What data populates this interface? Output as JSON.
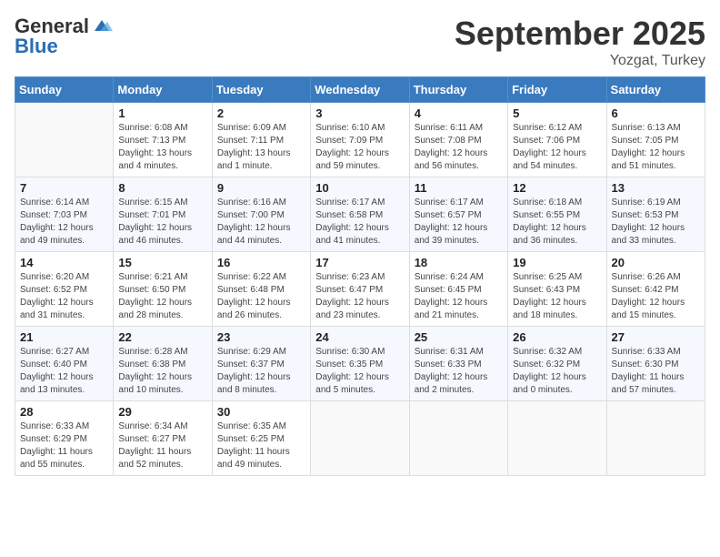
{
  "logo": {
    "general": "General",
    "blue": "Blue"
  },
  "header": {
    "title": "September 2025",
    "subtitle": "Yozgat, Turkey"
  },
  "weekdays": [
    "Sunday",
    "Monday",
    "Tuesday",
    "Wednesday",
    "Thursday",
    "Friday",
    "Saturday"
  ],
  "weeks": [
    [
      {
        "day": "",
        "sunrise": "",
        "sunset": "",
        "daylight": ""
      },
      {
        "day": "1",
        "sunrise": "Sunrise: 6:08 AM",
        "sunset": "Sunset: 7:13 PM",
        "daylight": "Daylight: 13 hours and 4 minutes."
      },
      {
        "day": "2",
        "sunrise": "Sunrise: 6:09 AM",
        "sunset": "Sunset: 7:11 PM",
        "daylight": "Daylight: 13 hours and 1 minute."
      },
      {
        "day": "3",
        "sunrise": "Sunrise: 6:10 AM",
        "sunset": "Sunset: 7:09 PM",
        "daylight": "Daylight: 12 hours and 59 minutes."
      },
      {
        "day": "4",
        "sunrise": "Sunrise: 6:11 AM",
        "sunset": "Sunset: 7:08 PM",
        "daylight": "Daylight: 12 hours and 56 minutes."
      },
      {
        "day": "5",
        "sunrise": "Sunrise: 6:12 AM",
        "sunset": "Sunset: 7:06 PM",
        "daylight": "Daylight: 12 hours and 54 minutes."
      },
      {
        "day": "6",
        "sunrise": "Sunrise: 6:13 AM",
        "sunset": "Sunset: 7:05 PM",
        "daylight": "Daylight: 12 hours and 51 minutes."
      }
    ],
    [
      {
        "day": "7",
        "sunrise": "Sunrise: 6:14 AM",
        "sunset": "Sunset: 7:03 PM",
        "daylight": "Daylight: 12 hours and 49 minutes."
      },
      {
        "day": "8",
        "sunrise": "Sunrise: 6:15 AM",
        "sunset": "Sunset: 7:01 PM",
        "daylight": "Daylight: 12 hours and 46 minutes."
      },
      {
        "day": "9",
        "sunrise": "Sunrise: 6:16 AM",
        "sunset": "Sunset: 7:00 PM",
        "daylight": "Daylight: 12 hours and 44 minutes."
      },
      {
        "day": "10",
        "sunrise": "Sunrise: 6:17 AM",
        "sunset": "Sunset: 6:58 PM",
        "daylight": "Daylight: 12 hours and 41 minutes."
      },
      {
        "day": "11",
        "sunrise": "Sunrise: 6:17 AM",
        "sunset": "Sunset: 6:57 PM",
        "daylight": "Daylight: 12 hours and 39 minutes."
      },
      {
        "day": "12",
        "sunrise": "Sunrise: 6:18 AM",
        "sunset": "Sunset: 6:55 PM",
        "daylight": "Daylight: 12 hours and 36 minutes."
      },
      {
        "day": "13",
        "sunrise": "Sunrise: 6:19 AM",
        "sunset": "Sunset: 6:53 PM",
        "daylight": "Daylight: 12 hours and 33 minutes."
      }
    ],
    [
      {
        "day": "14",
        "sunrise": "Sunrise: 6:20 AM",
        "sunset": "Sunset: 6:52 PM",
        "daylight": "Daylight: 12 hours and 31 minutes."
      },
      {
        "day": "15",
        "sunrise": "Sunrise: 6:21 AM",
        "sunset": "Sunset: 6:50 PM",
        "daylight": "Daylight: 12 hours and 28 minutes."
      },
      {
        "day": "16",
        "sunrise": "Sunrise: 6:22 AM",
        "sunset": "Sunset: 6:48 PM",
        "daylight": "Daylight: 12 hours and 26 minutes."
      },
      {
        "day": "17",
        "sunrise": "Sunrise: 6:23 AM",
        "sunset": "Sunset: 6:47 PM",
        "daylight": "Daylight: 12 hours and 23 minutes."
      },
      {
        "day": "18",
        "sunrise": "Sunrise: 6:24 AM",
        "sunset": "Sunset: 6:45 PM",
        "daylight": "Daylight: 12 hours and 21 minutes."
      },
      {
        "day": "19",
        "sunrise": "Sunrise: 6:25 AM",
        "sunset": "Sunset: 6:43 PM",
        "daylight": "Daylight: 12 hours and 18 minutes."
      },
      {
        "day": "20",
        "sunrise": "Sunrise: 6:26 AM",
        "sunset": "Sunset: 6:42 PM",
        "daylight": "Daylight: 12 hours and 15 minutes."
      }
    ],
    [
      {
        "day": "21",
        "sunrise": "Sunrise: 6:27 AM",
        "sunset": "Sunset: 6:40 PM",
        "daylight": "Daylight: 12 hours and 13 minutes."
      },
      {
        "day": "22",
        "sunrise": "Sunrise: 6:28 AM",
        "sunset": "Sunset: 6:38 PM",
        "daylight": "Daylight: 12 hours and 10 minutes."
      },
      {
        "day": "23",
        "sunrise": "Sunrise: 6:29 AM",
        "sunset": "Sunset: 6:37 PM",
        "daylight": "Daylight: 12 hours and 8 minutes."
      },
      {
        "day": "24",
        "sunrise": "Sunrise: 6:30 AM",
        "sunset": "Sunset: 6:35 PM",
        "daylight": "Daylight: 12 hours and 5 minutes."
      },
      {
        "day": "25",
        "sunrise": "Sunrise: 6:31 AM",
        "sunset": "Sunset: 6:33 PM",
        "daylight": "Daylight: 12 hours and 2 minutes."
      },
      {
        "day": "26",
        "sunrise": "Sunrise: 6:32 AM",
        "sunset": "Sunset: 6:32 PM",
        "daylight": "Daylight: 12 hours and 0 minutes."
      },
      {
        "day": "27",
        "sunrise": "Sunrise: 6:33 AM",
        "sunset": "Sunset: 6:30 PM",
        "daylight": "Daylight: 11 hours and 57 minutes."
      }
    ],
    [
      {
        "day": "28",
        "sunrise": "Sunrise: 6:33 AM",
        "sunset": "Sunset: 6:29 PM",
        "daylight": "Daylight: 11 hours and 55 minutes."
      },
      {
        "day": "29",
        "sunrise": "Sunrise: 6:34 AM",
        "sunset": "Sunset: 6:27 PM",
        "daylight": "Daylight: 11 hours and 52 minutes."
      },
      {
        "day": "30",
        "sunrise": "Sunrise: 6:35 AM",
        "sunset": "Sunset: 6:25 PM",
        "daylight": "Daylight: 11 hours and 49 minutes."
      },
      {
        "day": "",
        "sunrise": "",
        "sunset": "",
        "daylight": ""
      },
      {
        "day": "",
        "sunrise": "",
        "sunset": "",
        "daylight": ""
      },
      {
        "day": "",
        "sunrise": "",
        "sunset": "",
        "daylight": ""
      },
      {
        "day": "",
        "sunrise": "",
        "sunset": "",
        "daylight": ""
      }
    ]
  ]
}
